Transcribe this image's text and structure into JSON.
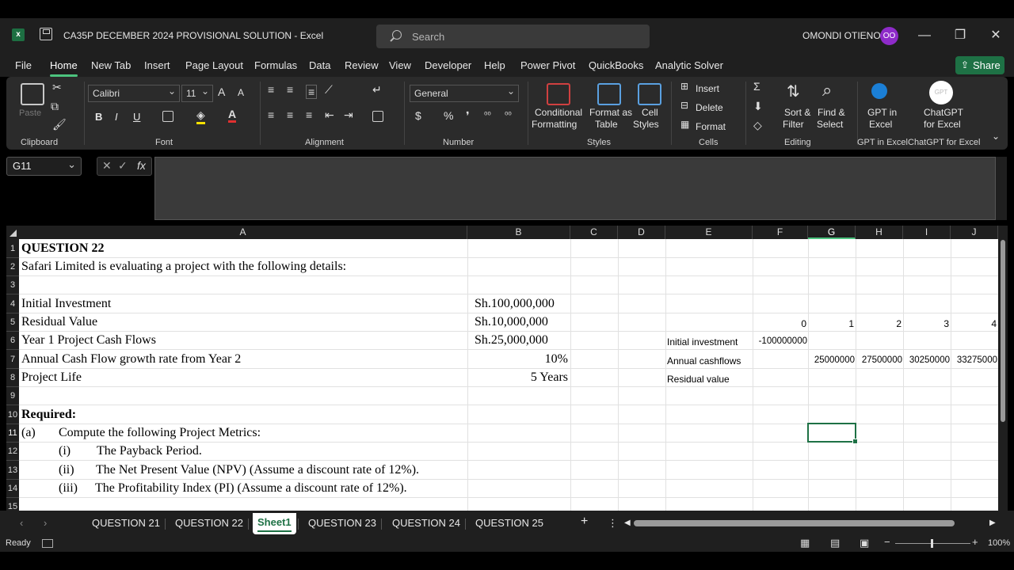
{
  "titlebar": {
    "doc_title": "CA35P DECEMBER 2024 PROVISIONAL SOLUTION  -  Excel",
    "search_placeholder": "Search",
    "username": "OMONDI OTIENO",
    "avatar_initials": "OO",
    "minimize": "—",
    "restore": "❐",
    "close": "✕"
  },
  "menu": {
    "items": [
      "File",
      "Home",
      "New Tab",
      "Insert",
      "Page Layout",
      "Formulas",
      "Data",
      "Review",
      "View",
      "Developer",
      "Help",
      "Power Pivot",
      "QuickBooks",
      "Analytic Solver"
    ],
    "active": "Home",
    "share": "Share"
  },
  "ribbon": {
    "clipboard": {
      "paste": "Paste",
      "label": "Clipboard"
    },
    "font": {
      "name": "Calibri",
      "size": "11",
      "bold": "B",
      "italic": "I",
      "underline": "U",
      "label": "Font"
    },
    "alignment": {
      "label": "Alignment"
    },
    "number": {
      "format": "General",
      "label": "Number"
    },
    "styles": {
      "conditional": "Conditional",
      "conditional2": "Formatting",
      "format_table": "Format as",
      "format_table2": "Table",
      "cell_styles": "Cell",
      "cell_styles2": "Styles",
      "label": "Styles"
    },
    "cells": {
      "insert": "Insert",
      "delete": "Delete",
      "format": "Format",
      "label": "Cells"
    },
    "editing": {
      "sort": "Sort &",
      "sort2": "Filter",
      "find": "Find &",
      "find2": "Select",
      "label": "Editing"
    },
    "gpt_excel": {
      "line1": "GPT in",
      "line2": "Excel",
      "label": "GPT in Excel"
    },
    "chatgpt": {
      "line1": "ChatGPT",
      "line2": "for Excel",
      "label": "ChatGPT for Excel",
      "icon_text": "GPT"
    }
  },
  "formula_bar": {
    "name_box": "G11",
    "formula": ""
  },
  "sheet": {
    "columns": [
      "A",
      "B",
      "C",
      "D",
      "E",
      "F",
      "G",
      "H",
      "I",
      "J"
    ],
    "selected_column": "G",
    "rows": [
      "1",
      "2",
      "3",
      "4",
      "5",
      "6",
      "7",
      "8",
      "9",
      "10",
      "11",
      "12",
      "13",
      "14",
      "15"
    ],
    "selected_row": "11",
    "cells": {
      "a1": "QUESTION 22",
      "a2": "Safari Limited is evaluating a project with the following details:",
      "a4": "Initial Investment",
      "b4": "Sh.100,000,000",
      "a5": "Residual Value",
      "b5": "Sh.10,000,000",
      "a6": "Year 1 Project Cash Flows",
      "b6": "Sh.25,000,000",
      "a7": "Annual Cash Flow growth rate from Year 2",
      "b7": "10%",
      "a8": "Project Life",
      "b8": "5 Years",
      "a10": "Required:",
      "a11_num": "(a)",
      "a11_text": "Compute the following Project Metrics:",
      "a12_num": "(i)",
      "a12_text": "The Payback Period.",
      "a13_num": "(ii)",
      "a13_text": "The Net Present Value (NPV) (Assume a discount rate of 12%).",
      "a14_num": "(iii)",
      "a14_text": "The Profitability Index (PI) (Assume a discount rate of 12%).",
      "f5": "0",
      "g5": "1",
      "h5": "2",
      "i5": "3",
      "j5": "4",
      "e6": "Initial investment",
      "f6": "-100000000",
      "e7": "Annual cashflows",
      "g7": "25000000",
      "h7": "27500000",
      "i7": "30250000",
      "j7": "33275000",
      "e8": "Residual value"
    }
  },
  "tabs": {
    "items": [
      "QUESTION 21",
      "QUESTION 22",
      "Sheet1",
      "QUESTION 23",
      "QUESTION 24",
      "QUESTION 25"
    ],
    "active": "Sheet1",
    "add": "+",
    "more": "⋮"
  },
  "status": {
    "ready": "Ready",
    "zoom": "100%"
  }
}
